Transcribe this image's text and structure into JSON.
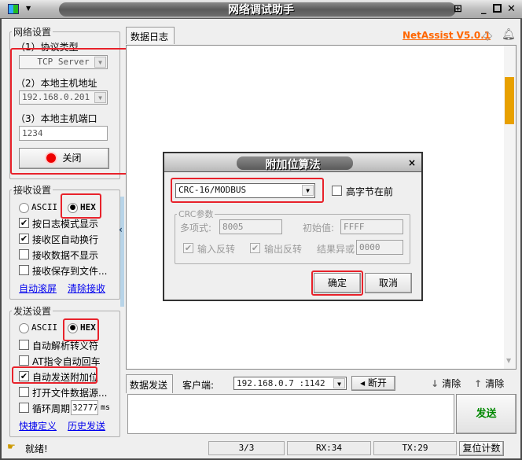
{
  "window": {
    "title": "网络调试助手",
    "version_link": "NetAssist V5.0.1"
  },
  "network_settings": {
    "title": "网络设置",
    "protocol_label": "（1）协议类型",
    "protocol_value": "TCP Server",
    "host_label": "（2）本地主机地址",
    "host_value": "192.168.0.201",
    "port_label": "（3）本地主机端口",
    "port_value": "1234",
    "close_button": "关闭"
  },
  "receive_settings": {
    "title": "接收设置",
    "ascii": "ASCII",
    "hex": "HEX",
    "selected": "HEX",
    "options": [
      {
        "label": "按日志模式显示",
        "checked": true
      },
      {
        "label": "接收区自动换行",
        "checked": true
      },
      {
        "label": "接收数据不显示",
        "checked": false
      },
      {
        "label": "接收保存到文件...",
        "checked": false
      }
    ],
    "link_autoscroll": "自动滚屏",
    "link_clear": "清除接收"
  },
  "send_settings": {
    "title": "发送设置",
    "ascii": "ASCII",
    "hex": "HEX",
    "selected": "HEX",
    "options": [
      {
        "label": "自动解析转义符",
        "checked": false
      },
      {
        "label": "AT指令自动回车",
        "checked": false
      },
      {
        "label": "自动发送附加位",
        "checked": true
      },
      {
        "label": "打开文件数据源...",
        "checked": false
      },
      {
        "label": "循环周期",
        "checked": false
      }
    ],
    "period_value": "32777",
    "period_unit": "ms",
    "link_shortcut": "快捷定义",
    "link_history": "历史发送"
  },
  "log": {
    "tab": "数据日志"
  },
  "send_area": {
    "tab": "数据发送",
    "client_label": "客户端:",
    "client_value": "192.168.0.7 :1142",
    "disconnect": "断开",
    "clear1": "清除",
    "clear2": "清除",
    "send": "发送",
    "text": ""
  },
  "dialog": {
    "title": "附加位算法",
    "close": "×",
    "algorithm": "CRC-16/MODBUS",
    "high_byte_first_label": "高字节在前",
    "high_byte_first": false,
    "crc_group": "CRC参数",
    "poly_label": "多项式:",
    "poly_value": "8005",
    "init_label": "初始值:",
    "init_value": "FFFF",
    "refin_label": "输入反转",
    "refin": true,
    "refout_label": "输出反转",
    "refout": true,
    "xorout_label": "结果异或",
    "xorout_value": "0000",
    "ok": "确定",
    "cancel": "取消"
  },
  "status": {
    "text": "就绪!",
    "count": "3/3",
    "rx": "RX:34",
    "tx": "TX:29",
    "reset": "复位计数"
  }
}
